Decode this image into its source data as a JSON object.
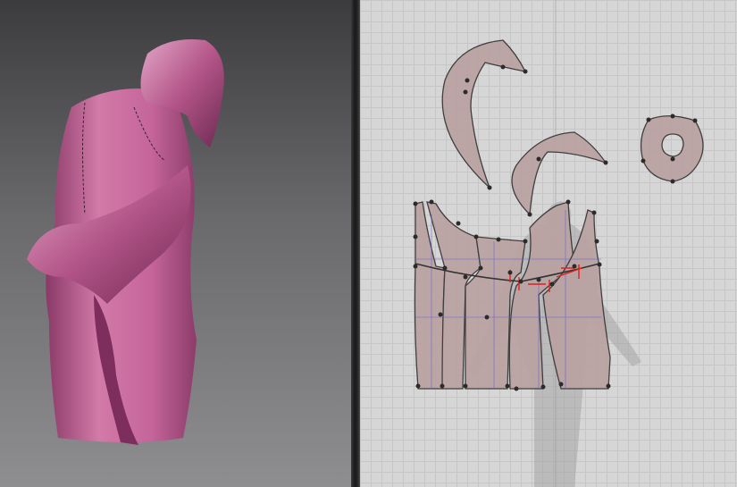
{
  "viewport_3d": {
    "garment_color": "#c8709e",
    "background_top": "#3c3c3f",
    "background_bottom": "#8e8e90"
  },
  "viewport_2d": {
    "pattern_fill": "#b9a2a1",
    "pattern_outline": "#333333",
    "internal_line_color": "#6a5fd6",
    "selected_segment_color": "#e0201c",
    "background": "#d6d6d6"
  }
}
